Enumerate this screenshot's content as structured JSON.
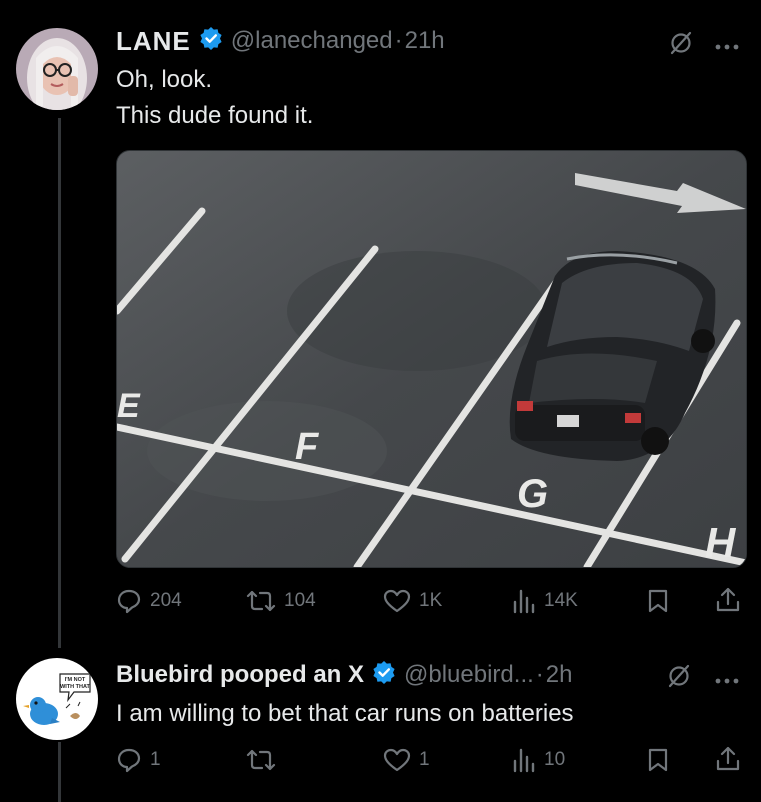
{
  "tweet1": {
    "display_name": "LANE",
    "handle": "@lanechanged",
    "separator": "·",
    "time": "21h",
    "text_line1": "Oh, look.",
    "text_line2": "This dude found it.",
    "media": {
      "icon": "parking-lot-photo-icon",
      "space_labels": [
        "E",
        "F",
        "G",
        "H"
      ]
    },
    "actions": {
      "replies": "204",
      "reposts": "104",
      "likes": "1K",
      "views": "14K"
    }
  },
  "tweet2": {
    "display_name": "Bluebird pooped an X",
    "handle": "@bluebird...",
    "separator": "·",
    "time": "2h",
    "text": "I am willing to bet that car runs on batteries",
    "avatar_sign": "I'M NOT WITH THAT",
    "actions": {
      "replies": "1",
      "reposts": "",
      "likes": "1",
      "views": "10"
    }
  },
  "colors": {
    "background": "#000000",
    "text": "#e7e9ea",
    "muted": "#71767b",
    "verified": "#1d9bf0"
  }
}
